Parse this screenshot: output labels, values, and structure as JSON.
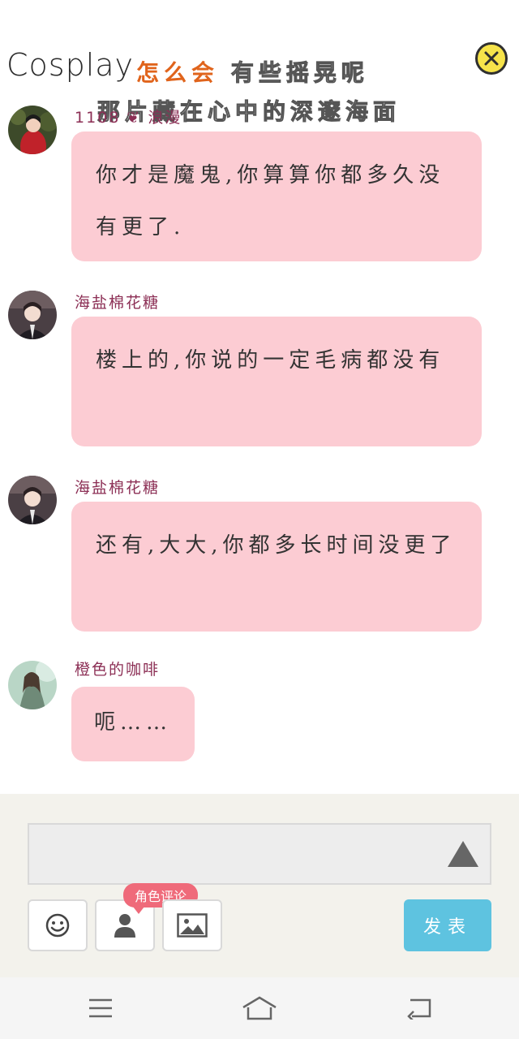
{
  "header": {
    "title": "Cosplay",
    "headline_accent": "怎么会",
    "headline_rest": "有些摇晃呢",
    "headline_line2": "那片藏在心中的深邃海面"
  },
  "messages": [
    {
      "username": "1108 ❦ 浪漫",
      "text": "你才是魔鬼,你算算你都多久没有更了.",
      "avatar_icon": "avatar-red-costume"
    },
    {
      "username": "海盐棉花糖",
      "text": "楼上的,你说的一定毛病都没有",
      "avatar_icon": "avatar-boy-suit"
    },
    {
      "username": "海盐棉花糖",
      "text": "还有,大大,你都多长时间没更了",
      "avatar_icon": "avatar-boy-suit"
    },
    {
      "username": "橙色的咖啡",
      "text": "呃……",
      "avatar_icon": "avatar-girl-green"
    }
  ],
  "compose": {
    "input_value": "",
    "role_badge": "角色评论",
    "send_label": "发表",
    "tools": [
      "emoji-icon",
      "person-icon",
      "image-icon"
    ]
  },
  "colors": {
    "bubble": "#fcccd3",
    "username": "#8c2f55",
    "accent": "#e0641c",
    "send": "#5ec3e0",
    "badge": "#ef6a7a",
    "close": "#f6e34a"
  },
  "navbar": {
    "icons": [
      "menu-icon",
      "home-icon",
      "back-icon"
    ]
  }
}
